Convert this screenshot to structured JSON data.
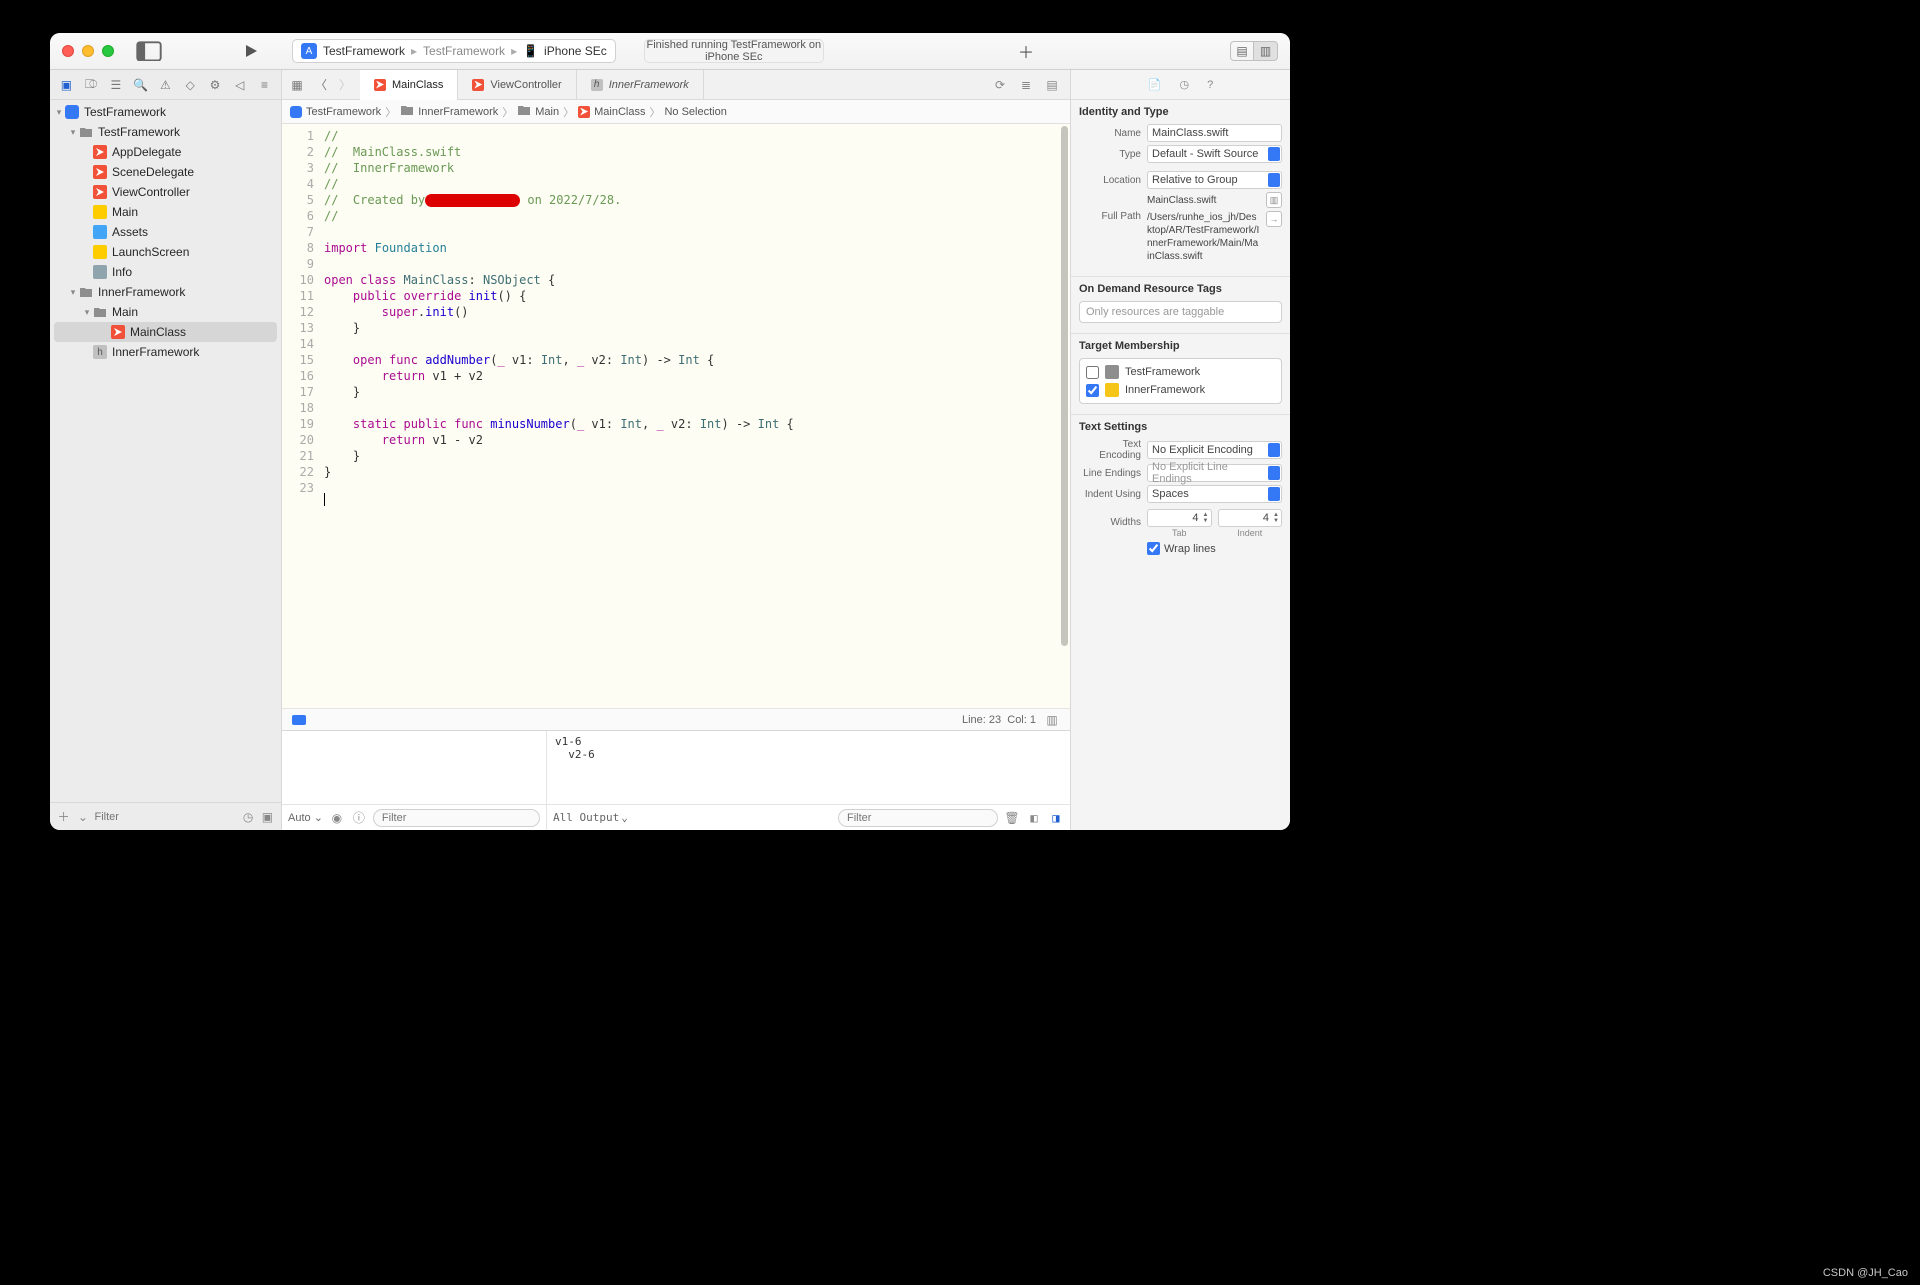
{
  "titlebar": {
    "scheme_name": "TestFramework",
    "scheme_target_left": "TestFramework",
    "scheme_target_right": "iPhone SEc",
    "status": "Finished running TestFramework on iPhone SEc"
  },
  "nav": {
    "filter_placeholder": "Filter",
    "tree": {
      "root": "TestFramework",
      "group1": "TestFramework",
      "g1_items": [
        "AppDelegate",
        "SceneDelegate",
        "ViewController",
        "Main",
        "Assets",
        "LaunchScreen",
        "Info"
      ],
      "group2": "InnerFramework",
      "g2_main": "Main",
      "g2_main_items": [
        "MainClass"
      ],
      "g2_header": "InnerFramework"
    }
  },
  "tabs": {
    "items": [
      {
        "label": "MainClass",
        "kind": "swift",
        "active": true
      },
      {
        "label": "ViewController",
        "kind": "swift",
        "active": false
      },
      {
        "label": "InnerFramework",
        "kind": "header",
        "active": false,
        "italic": true
      }
    ]
  },
  "jumpbar": {
    "segs": [
      "TestFramework",
      "InnerFramework",
      "Main",
      "MainClass",
      "No Selection"
    ]
  },
  "code": {
    "lines": [
      {
        "n": 1,
        "html": "<span class='cm'>//</span>"
      },
      {
        "n": 2,
        "html": "<span class='cm'>//  MainClass.swift</span>"
      },
      {
        "n": 3,
        "html": "<span class='cm'>//  InnerFramework</span>"
      },
      {
        "n": 4,
        "html": "<span class='cm'>//</span>"
      },
      {
        "n": 5,
        "html": "<span class='cm'>//  Created by</span><span class='redact'></span><span class='cm'> on 2022/7/28.</span>"
      },
      {
        "n": 6,
        "html": "<span class='cm'>//</span>"
      },
      {
        "n": 7,
        "html": ""
      },
      {
        "n": 8,
        "html": "<span class='kw'>import</span> <span class='id'>Foundation</span>"
      },
      {
        "n": 9,
        "html": ""
      },
      {
        "n": 10,
        "html": "<span class='kw'>open</span> <span class='kw'>class</span> <span class='ty'>MainClass</span>: <span class='ty'>NSObject</span> {"
      },
      {
        "n": 11,
        "html": "    <span class='kw'>public</span> <span class='kw'>override</span> <span class='fn'>init</span>() {"
      },
      {
        "n": 12,
        "html": "        <span class='kw'>super</span>.<span class='fn'>init</span>()"
      },
      {
        "n": 13,
        "html": "    }"
      },
      {
        "n": 14,
        "html": ""
      },
      {
        "n": 15,
        "html": "    <span class='kw'>open</span> <span class='kw'>func</span> <span class='fn'>addNumber</span>(<span class='kw'>_</span> v1: <span class='ty'>Int</span>, <span class='kw'>_</span> v2: <span class='ty'>Int</span>) -&gt; <span class='ty'>Int</span> {"
      },
      {
        "n": 16,
        "html": "        <span class='kw'>return</span> v1 + v2"
      },
      {
        "n": 17,
        "html": "    }"
      },
      {
        "n": 18,
        "html": ""
      },
      {
        "n": 19,
        "html": "    <span class='kw'>static</span> <span class='kw'>public</span> <span class='kw'>func</span> <span class='fn'>minusNumber</span>(<span class='kw'>_</span> v1: <span class='ty'>Int</span>, <span class='kw'>_</span> v2: <span class='ty'>Int</span>) -&gt; <span class='ty'>Int</span> {"
      },
      {
        "n": 20,
        "html": "        <span class='kw'>return</span> v1 - v2"
      },
      {
        "n": 21,
        "html": "    }"
      },
      {
        "n": 22,
        "html": "}"
      },
      {
        "n": 23,
        "html": "<span class='cursor-line'></span>",
        "hl": true
      }
    ]
  },
  "status_line": {
    "line": "Line: 23",
    "col": "Col: 1"
  },
  "debug": {
    "auto": "Auto",
    "filter_placeholder": "Filter",
    "all_output": "All Output",
    "console": "v1-6\n  v2-6"
  },
  "inspector": {
    "identity_title": "Identity and Type",
    "name_label": "Name",
    "name_val": "MainClass.swift",
    "type_label": "Type",
    "type_val": "Default - Swift Source",
    "loc_label": "Location",
    "loc_val": "Relative to Group",
    "loc_file": "MainClass.swift",
    "fullpath_label": "Full Path",
    "fullpath_val": "/Users/runhe_ios_jh/Desktop/AR/TestFramework/InnerFramework/Main/MainClass.swift",
    "odr_title": "On Demand Resource Tags",
    "odr_placeholder": "Only resources are taggable",
    "tm_title": "Target Membership",
    "tm_items": [
      {
        "name": "TestFramework",
        "checked": false,
        "kind": "app"
      },
      {
        "name": "InnerFramework",
        "checked": true,
        "kind": "fw"
      }
    ],
    "ts_title": "Text Settings",
    "te_label": "Text Encoding",
    "te_val": "No Explicit Encoding",
    "le_label": "Line Endings",
    "le_val": "No Explicit Line Endings",
    "iu_label": "Indent Using",
    "iu_val": "Spaces",
    "w_label": "Widths",
    "w_tab": "4",
    "w_tab_lbl": "Tab",
    "w_ind": "4",
    "w_ind_lbl": "Indent",
    "wrap_label": "Wrap lines"
  },
  "watermark": "CSDN @JH_Cao"
}
